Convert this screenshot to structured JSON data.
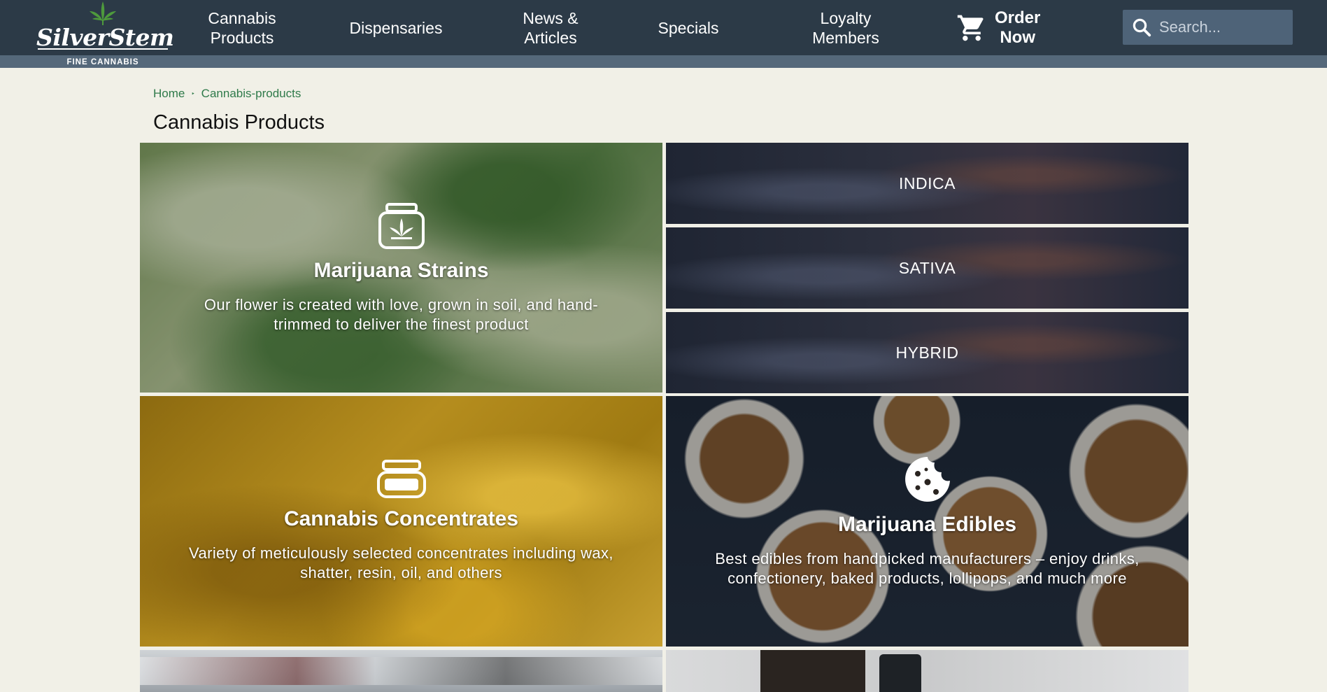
{
  "brand": {
    "name": "SilverStem",
    "tagline": "FINE CANNABIS",
    "colors": {
      "header_bg": "#2c3a47",
      "strip": "#55687a",
      "accent_green": "#2f7a4a",
      "page_bg": "#f1f0e7"
    }
  },
  "nav": {
    "items": [
      {
        "label": "Cannabis\nProducts"
      },
      {
        "label": "Dispensaries"
      },
      {
        "label": "News &\nArticles"
      },
      {
        "label": "Specials"
      },
      {
        "label": "Loyalty\nMembers"
      }
    ],
    "order_label": "Order\nNow",
    "order_icon": "cart-icon",
    "search_placeholder": "Search...",
    "search_icon": "search-icon"
  },
  "breadcrumb": {
    "home": "Home",
    "separator": "‣",
    "current": "Cannabis-products"
  },
  "page_title": "Cannabis Products",
  "tiles": {
    "strains": {
      "icon": "jar-leaf-icon",
      "title": "Marijuana Strains",
      "description": "Our flower is created with love, grown in soil, and hand-trimmed to deliver the finest product"
    },
    "strain_types": [
      "INDICA",
      "SATIVA",
      "HYBRID"
    ],
    "concentrates": {
      "icon": "concentrate-jar-icon",
      "title": "Cannabis Concentrates",
      "description": "Variety of meticulously selected concentrates including wax, shatter, resin, oil, and others"
    },
    "edibles": {
      "icon": "cookie-icon",
      "title": "Marijuana Edibles",
      "description": "Best edibles from handpicked manufacturers – enjoy drinks, confectionery, baked products, lollipops, and much more"
    }
  }
}
